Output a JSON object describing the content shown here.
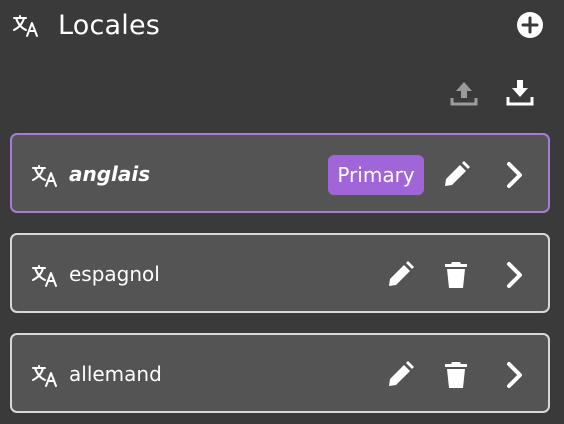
{
  "header": {
    "title": "Locales",
    "translate_icon": "translate-icon",
    "add_icon": "add-circle-icon"
  },
  "toolbar": {
    "upload_icon": "upload-icon",
    "download_icon": "download-icon",
    "upload_enabled": false
  },
  "locales": [
    {
      "name": "anglais",
      "primary": true,
      "badge": "Primary",
      "deletable": false
    },
    {
      "name": "espagnol",
      "primary": false,
      "badge": "",
      "deletable": true
    },
    {
      "name": "allemand",
      "primary": false,
      "badge": "",
      "deletable": true
    }
  ],
  "colors": {
    "background": "#3a3a3a",
    "row_background": "#545454",
    "row_border": "#d8d8d8",
    "primary_border": "#a87ad8",
    "badge": "#a066d9",
    "disabled_icon": "#9a9a9a"
  }
}
